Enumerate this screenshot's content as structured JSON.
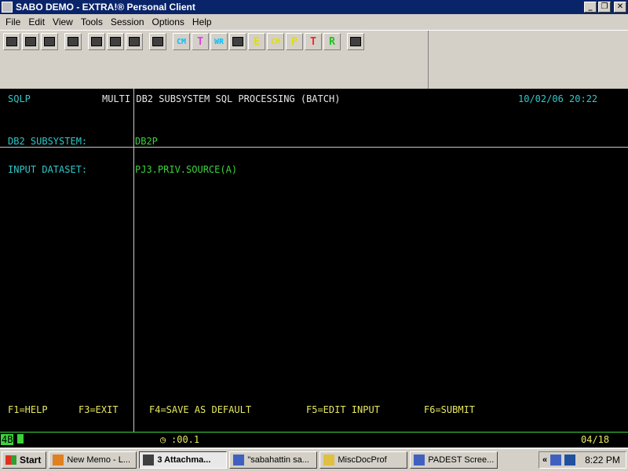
{
  "window": {
    "title": "SABO DEMO - EXTRA!® Personal Client"
  },
  "menu": [
    "File",
    "Edit",
    "View",
    "Tools",
    "Session",
    "Options",
    "Help"
  ],
  "toolbar": {
    "buttons": [
      {
        "name": "new-session-icon",
        "glyph": ""
      },
      {
        "name": "open-icon",
        "glyph": ""
      },
      {
        "name": "save-icon",
        "glyph": ""
      },
      {
        "name": "print-icon",
        "glyph": ""
      },
      {
        "name": "cut-icon",
        "glyph": ""
      },
      {
        "name": "copy-icon",
        "glyph": ""
      },
      {
        "name": "paste-icon",
        "glyph": ""
      },
      {
        "name": "macro-icon",
        "glyph": ""
      },
      {
        "name": "cm-macro-icon",
        "glyph": "CM",
        "color": "#00c0ff"
      },
      {
        "name": "t-macro-icon",
        "glyph": "T",
        "color": "#e040e0"
      },
      {
        "name": "wr-macro-icon",
        "glyph": "WR",
        "color": "#00c0ff"
      },
      {
        "name": "run-macro-icon",
        "glyph": ""
      },
      {
        "name": "e-macro-icon",
        "glyph": "E",
        "color": "#e0e000"
      },
      {
        "name": "cm-yellow-macro-icon",
        "glyph": "CM",
        "color": "#e0e000"
      },
      {
        "name": "p-macro-icon",
        "glyph": "P",
        "color": "#e0e000"
      },
      {
        "name": "t-red-macro-icon",
        "glyph": "T",
        "color": "#ff2020"
      },
      {
        "name": "r-macro-icon",
        "glyph": "R",
        "color": "#20c020"
      },
      {
        "name": "settings-macro-icon",
        "glyph": ""
      }
    ]
  },
  "screen": {
    "program_id": "SQLP",
    "heading": "MULTI DB2 SUBSYSTEM SQL PROCESSING (BATCH)",
    "datetime": "10/02/06 20:22",
    "subsystem_label": "DB2 SUBSYSTEM:",
    "subsystem_value": "DB2P",
    "dataset_label": "INPUT DATASET:",
    "dataset_value": "PJ3.PRIV.SOURCE(A)",
    "function_keys": [
      "F1=HELP",
      "F3=EXIT",
      "F4=SAVE AS DEFAULT",
      "F5=EDIT INPUT",
      "F6=SUBMIT"
    ]
  },
  "status": {
    "session": "4B",
    "timer": ":00.1",
    "cursor_pos": "04/18"
  },
  "taskbar": {
    "start_label": "Start",
    "tasks": [
      {
        "label": "New Memo - L...",
        "color": "#e08020"
      },
      {
        "label": "3 Attachma...",
        "color": "#404040",
        "active": true
      },
      {
        "label": "\"sabahattin sa...",
        "color": "#4060c0"
      },
      {
        "label": "MiscDocProf",
        "color": "#e0c040"
      },
      {
        "label": "PADEST Scree...",
        "color": "#4060c0"
      }
    ],
    "clock": "8:22 PM"
  }
}
